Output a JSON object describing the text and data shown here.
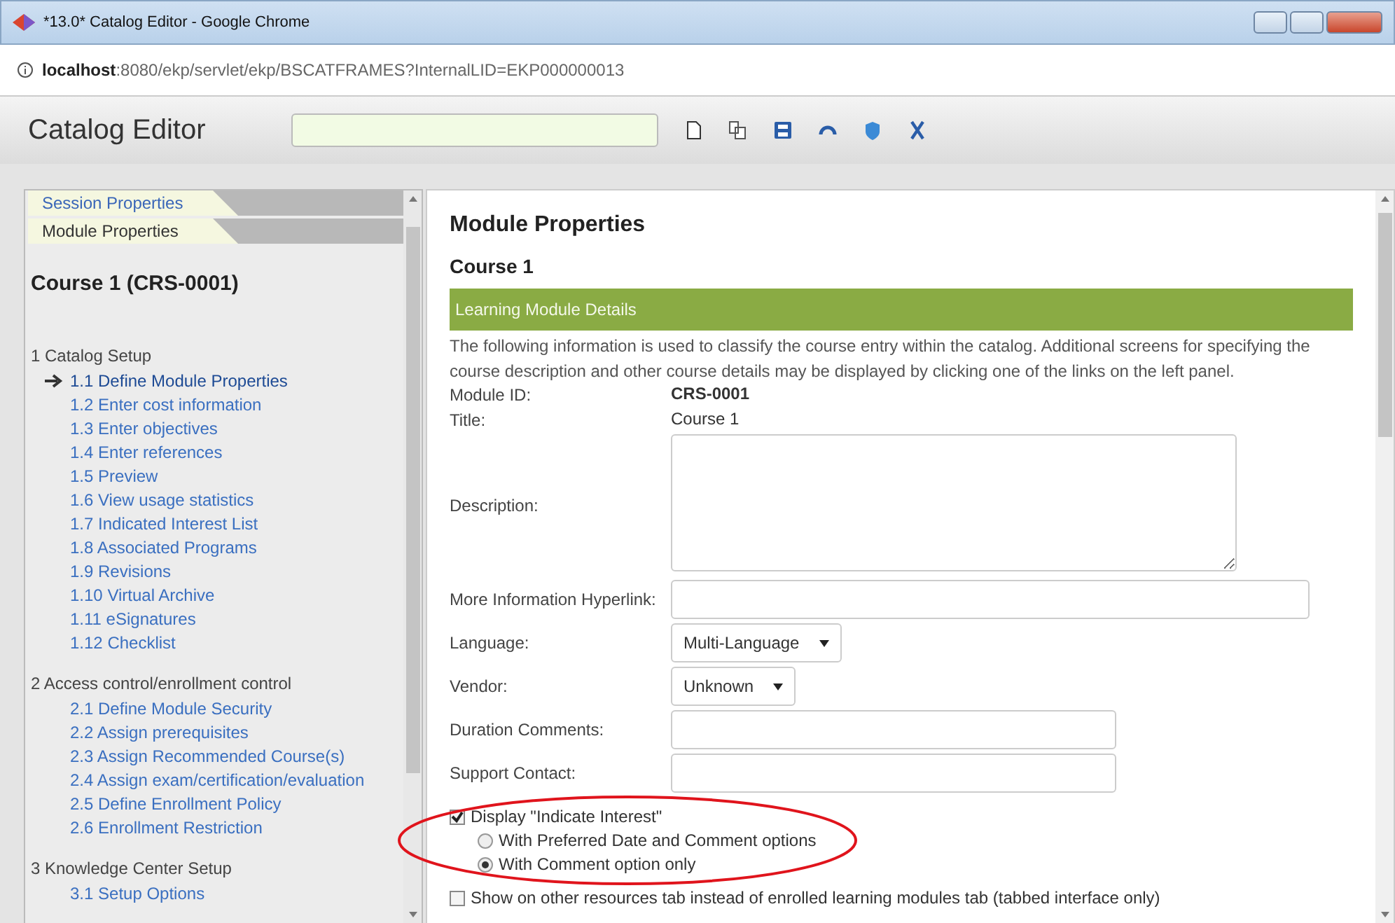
{
  "window": {
    "title": "*13.0* Catalog Editor - Google Chrome"
  },
  "address_bar": {
    "host": "localhost",
    "path": ":8080/ekp/servlet/ekp/BSCATFRAMES?InternalLID=EKP000000013"
  },
  "app_header": {
    "title": "Catalog Editor"
  },
  "sidebar": {
    "tabs": [
      {
        "label": "Session Properties",
        "selected": false
      },
      {
        "label": "Module Properties",
        "selected": true
      }
    ],
    "heading": "Course 1 (CRS-0001)",
    "sections": [
      {
        "label": "1 Catalog Setup",
        "children": [
          {
            "label": "1.1 Define Module Properties",
            "selected": true
          },
          {
            "label": "1.2 Enter cost information",
            "selected": false
          },
          {
            "label": "1.3 Enter objectives",
            "selected": false
          },
          {
            "label": "1.4 Enter references",
            "selected": false
          },
          {
            "label": "1.5 Preview",
            "selected": false
          },
          {
            "label": "1.6 View usage statistics",
            "selected": false
          },
          {
            "label": "1.7 Indicated Interest List",
            "selected": false
          },
          {
            "label": "1.8 Associated Programs",
            "selected": false
          },
          {
            "label": "1.9 Revisions",
            "selected": false
          },
          {
            "label": "1.10 Virtual Archive",
            "selected": false
          },
          {
            "label": "1.11 eSignatures",
            "selected": false
          },
          {
            "label": "1.12 Checklist",
            "selected": false
          }
        ]
      },
      {
        "label": "2 Access control/enrollment control",
        "children": [
          {
            "label": "2.1 Define Module Security",
            "selected": false
          },
          {
            "label": "2.2 Assign prerequisites",
            "selected": false
          },
          {
            "label": "2.3 Assign Recommended Course(s)",
            "selected": false
          },
          {
            "label": "2.4 Assign exam/certification/evaluation",
            "selected": false
          },
          {
            "label": "2.5 Define Enrollment Policy",
            "selected": false
          },
          {
            "label": "2.6 Enrollment Restriction",
            "selected": false
          }
        ]
      },
      {
        "label": "3 Knowledge Center Setup",
        "children": [
          {
            "label": "3.1 Setup Options",
            "selected": false
          }
        ]
      }
    ]
  },
  "content": {
    "title": "Module Properties",
    "subtitle": "Course 1",
    "section_header": "Learning Module Details",
    "intro": "The following information is used to classify the course entry within the catalog. Additional screens for specifying the course description and other course details may be displayed by clicking one of the links on the left panel.",
    "fields": [
      {
        "kind": "bold",
        "label": "Module ID:",
        "value": "CRS-0001"
      },
      {
        "kind": "static",
        "label": "Title:",
        "value": "Course 1"
      },
      {
        "kind": "textarea",
        "label": "Description:"
      },
      {
        "kind": "link",
        "label": "More Information Hyperlink:"
      },
      {
        "kind": "select",
        "label": "Language:",
        "value": "Multi-Language"
      },
      {
        "kind": "select",
        "label": "Vendor:",
        "value": "Unknown"
      },
      {
        "kind": "text",
        "label": "Duration Comments:"
      },
      {
        "kind": "text",
        "label": "Support Contact:"
      }
    ],
    "indicate_interest": {
      "label": "Display \"Indicate Interest\"",
      "checked": true,
      "options": [
        {
          "label": "With Preferred Date and Comment options",
          "selected": false
        },
        {
          "label": "With Comment option only",
          "selected": true
        }
      ]
    },
    "other_resources": {
      "label": "Show on other resources tab instead of enrolled learning modules tab (tabbed interface only)",
      "checked": false
    }
  }
}
